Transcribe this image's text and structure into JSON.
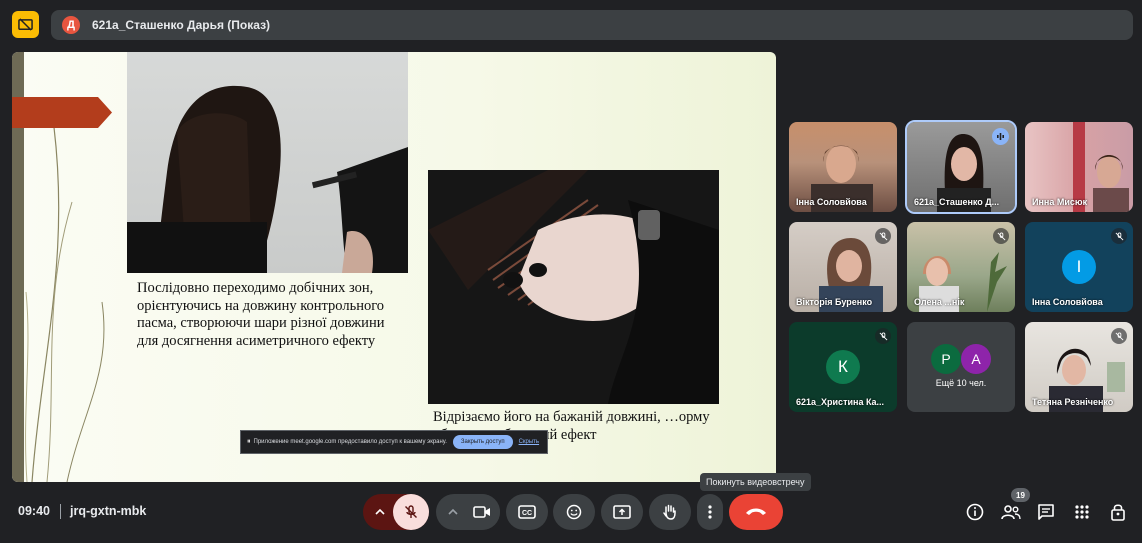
{
  "header": {
    "presenter_initial": "Д",
    "presenter_label": "621а_Сташенко Дарья (Показ)"
  },
  "slide": {
    "text_left": "Послідовно переходимо добічних зон, орієнтуючись на довжину контрольного пасма, створюючи шари різної довжини для досягнення асиметричного ефекту",
    "text_right": "Відрізаємо його на бажаній довжині, …орму обличчя та бажаний ефект"
  },
  "share_banner": {
    "message": "Приложение meet.google.com предоставило доступ к вашему экрану.",
    "stop_label": "Закрыть доступ",
    "hide_label": "Скрыть"
  },
  "participants": [
    {
      "name": "Інна Соловйова",
      "muted": false
    },
    {
      "name": "621а_Сташенко Д...",
      "muted": false,
      "speaking": true
    },
    {
      "name": "Инна Мисюк",
      "muted": false
    },
    {
      "name": "Вікторія Буренко",
      "muted": true
    },
    {
      "name": "Олена ...нік",
      "muted": true
    },
    {
      "name": "Інна Соловйова",
      "initial": "І",
      "muted": true
    },
    {
      "name": "621а_Христина Ка...",
      "initial": "К",
      "muted": true
    },
    {
      "more_initials": [
        "Р",
        "А"
      ],
      "more_label": "Ещё 10 чел."
    },
    {
      "name": "Тетяна Резніченко",
      "muted": true
    }
  ],
  "tooltip": "Покинуть видеовстречу",
  "bottom_bar": {
    "time": "09:40",
    "meeting_code": "jrq-gxtn-mbk",
    "participants_count": "19"
  },
  "colors": {
    "accent_blue": "#8ab4f8",
    "end_call_red": "#ea4335",
    "logo_yellow": "#fbbc04",
    "arrow_red": "#b33d1c"
  }
}
